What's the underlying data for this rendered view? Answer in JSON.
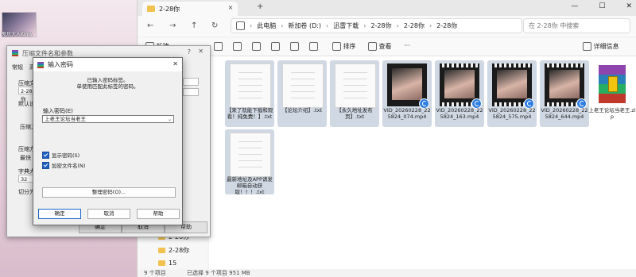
{
  "desktop": {
    "thumb_label": "鬼玫大人Kimy"
  },
  "explorer": {
    "tab_title": "2-28你",
    "tab_close": "×",
    "tab_add": "+",
    "window_controls": [
      "—",
      "☐",
      "✕"
    ],
    "nav": {
      "back": "←",
      "forward": "→",
      "up": "↑",
      "refresh": "↻"
    },
    "breadcrumb": [
      "此电脑",
      "新加卷 (D:)",
      "迅雷下载",
      "2-28你",
      "2-28你",
      "2-28你"
    ],
    "breadcrumb_sep": "›",
    "search_placeholder": "在 2-28你 中搜索",
    "toolbar": {
      "new": "新建",
      "sort": "排序",
      "view": "查看",
      "more": "···",
      "details": "详细信息"
    },
    "sidebar": [
      {
        "label": "2-28你"
      },
      {
        "label": "2-28你"
      },
      {
        "label": "15"
      }
    ],
    "files": [
      {
        "name": "【来了就能下载和观看！纯免费！】.txt",
        "kind": "doc"
      },
      {
        "name": "【论坛介绍】.txt",
        "kind": "doc"
      },
      {
        "name": "【永久地址发布页】.txt",
        "kind": "doc"
      },
      {
        "name": "VID_20260228_225824_074.mp4",
        "kind": "video"
      },
      {
        "name": "VID_20260228_225824_163.mp4",
        "kind": "video"
      },
      {
        "name": "VID_20260228_225824_575.mp4",
        "kind": "video"
      },
      {
        "name": "VID_20260228_225824_644.mp4",
        "kind": "video"
      },
      {
        "name": "上老王论坛当老王.zip",
        "kind": "zip"
      },
      {
        "name": "最新地址及APP请发邮箱自动获取！！！.txt",
        "kind": "doc"
      }
    ],
    "status": {
      "count": "9 个项目",
      "selected": "已选择 9 个项目 951 MB"
    }
  },
  "archive_dialog": {
    "title": "压缩文件名和参数",
    "help": "?",
    "close": "✕",
    "tab_general": "常规",
    "tab_advanced": "高",
    "labels": [
      "压缩文件",
      "默认设",
      "压缩方式",
      "压缩方",
      "最快",
      "字典大",
      "切分为"
    ],
    "archive_name": "2-28你",
    "dict_value": "32",
    "buttons": {
      "ok": "确定",
      "cancel": "取消",
      "help": "帮助"
    }
  },
  "password_dialog": {
    "title": "输入密码",
    "close": "✕",
    "note_line1": "已输入密码标签。",
    "note_line2": "单使用匹配此标签的密码。",
    "field_label": "输入密码(E)",
    "field_value": "上老王论坛当老王",
    "dropdown": "⌄",
    "show_password": "显示密码(S)",
    "encrypt_filenames": "加密文件名(N)",
    "organize": "整理密码(O)...",
    "ok": "确定",
    "cancel": "取消",
    "help": "帮助"
  }
}
